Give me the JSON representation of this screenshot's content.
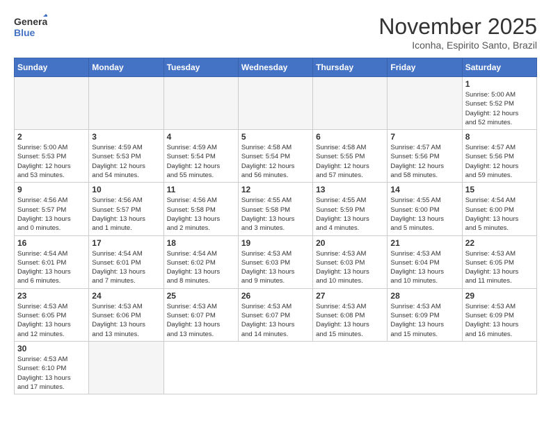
{
  "logo": {
    "line1": "General",
    "line2": "Blue"
  },
  "title": "November 2025",
  "location": "Iconha, Espirito Santo, Brazil",
  "weekdays": [
    "Sunday",
    "Monday",
    "Tuesday",
    "Wednesday",
    "Thursday",
    "Friday",
    "Saturday"
  ],
  "days": [
    {
      "num": "",
      "info": ""
    },
    {
      "num": "",
      "info": ""
    },
    {
      "num": "",
      "info": ""
    },
    {
      "num": "",
      "info": ""
    },
    {
      "num": "",
      "info": ""
    },
    {
      "num": "",
      "info": ""
    },
    {
      "num": "1",
      "info": "Sunrise: 5:00 AM\nSunset: 5:52 PM\nDaylight: 12 hours\nand 52 minutes."
    },
    {
      "num": "2",
      "info": "Sunrise: 5:00 AM\nSunset: 5:53 PM\nDaylight: 12 hours\nand 53 minutes."
    },
    {
      "num": "3",
      "info": "Sunrise: 4:59 AM\nSunset: 5:53 PM\nDaylight: 12 hours\nand 54 minutes."
    },
    {
      "num": "4",
      "info": "Sunrise: 4:59 AM\nSunset: 5:54 PM\nDaylight: 12 hours\nand 55 minutes."
    },
    {
      "num": "5",
      "info": "Sunrise: 4:58 AM\nSunset: 5:54 PM\nDaylight: 12 hours\nand 56 minutes."
    },
    {
      "num": "6",
      "info": "Sunrise: 4:58 AM\nSunset: 5:55 PM\nDaylight: 12 hours\nand 57 minutes."
    },
    {
      "num": "7",
      "info": "Sunrise: 4:57 AM\nSunset: 5:56 PM\nDaylight: 12 hours\nand 58 minutes."
    },
    {
      "num": "8",
      "info": "Sunrise: 4:57 AM\nSunset: 5:56 PM\nDaylight: 12 hours\nand 59 minutes."
    },
    {
      "num": "9",
      "info": "Sunrise: 4:56 AM\nSunset: 5:57 PM\nDaylight: 13 hours\nand 0 minutes."
    },
    {
      "num": "10",
      "info": "Sunrise: 4:56 AM\nSunset: 5:57 PM\nDaylight: 13 hours\nand 1 minute."
    },
    {
      "num": "11",
      "info": "Sunrise: 4:56 AM\nSunset: 5:58 PM\nDaylight: 13 hours\nand 2 minutes."
    },
    {
      "num": "12",
      "info": "Sunrise: 4:55 AM\nSunset: 5:58 PM\nDaylight: 13 hours\nand 3 minutes."
    },
    {
      "num": "13",
      "info": "Sunrise: 4:55 AM\nSunset: 5:59 PM\nDaylight: 13 hours\nand 4 minutes."
    },
    {
      "num": "14",
      "info": "Sunrise: 4:55 AM\nSunset: 6:00 PM\nDaylight: 13 hours\nand 5 minutes."
    },
    {
      "num": "15",
      "info": "Sunrise: 4:54 AM\nSunset: 6:00 PM\nDaylight: 13 hours\nand 5 minutes."
    },
    {
      "num": "16",
      "info": "Sunrise: 4:54 AM\nSunset: 6:01 PM\nDaylight: 13 hours\nand 6 minutes."
    },
    {
      "num": "17",
      "info": "Sunrise: 4:54 AM\nSunset: 6:01 PM\nDaylight: 13 hours\nand 7 minutes."
    },
    {
      "num": "18",
      "info": "Sunrise: 4:54 AM\nSunset: 6:02 PM\nDaylight: 13 hours\nand 8 minutes."
    },
    {
      "num": "19",
      "info": "Sunrise: 4:53 AM\nSunset: 6:03 PM\nDaylight: 13 hours\nand 9 minutes."
    },
    {
      "num": "20",
      "info": "Sunrise: 4:53 AM\nSunset: 6:03 PM\nDaylight: 13 hours\nand 10 minutes."
    },
    {
      "num": "21",
      "info": "Sunrise: 4:53 AM\nSunset: 6:04 PM\nDaylight: 13 hours\nand 10 minutes."
    },
    {
      "num": "22",
      "info": "Sunrise: 4:53 AM\nSunset: 6:05 PM\nDaylight: 13 hours\nand 11 minutes."
    },
    {
      "num": "23",
      "info": "Sunrise: 4:53 AM\nSunset: 6:05 PM\nDaylight: 13 hours\nand 12 minutes."
    },
    {
      "num": "24",
      "info": "Sunrise: 4:53 AM\nSunset: 6:06 PM\nDaylight: 13 hours\nand 13 minutes."
    },
    {
      "num": "25",
      "info": "Sunrise: 4:53 AM\nSunset: 6:07 PM\nDaylight: 13 hours\nand 13 minutes."
    },
    {
      "num": "26",
      "info": "Sunrise: 4:53 AM\nSunset: 6:07 PM\nDaylight: 13 hours\nand 14 minutes."
    },
    {
      "num": "27",
      "info": "Sunrise: 4:53 AM\nSunset: 6:08 PM\nDaylight: 13 hours\nand 15 minutes."
    },
    {
      "num": "28",
      "info": "Sunrise: 4:53 AM\nSunset: 6:09 PM\nDaylight: 13 hours\nand 15 minutes."
    },
    {
      "num": "29",
      "info": "Sunrise: 4:53 AM\nSunset: 6:09 PM\nDaylight: 13 hours\nand 16 minutes."
    },
    {
      "num": "30",
      "info": "Sunrise: 4:53 AM\nSunset: 6:10 PM\nDaylight: 13 hours\nand 17 minutes."
    },
    {
      "num": "",
      "info": ""
    }
  ]
}
